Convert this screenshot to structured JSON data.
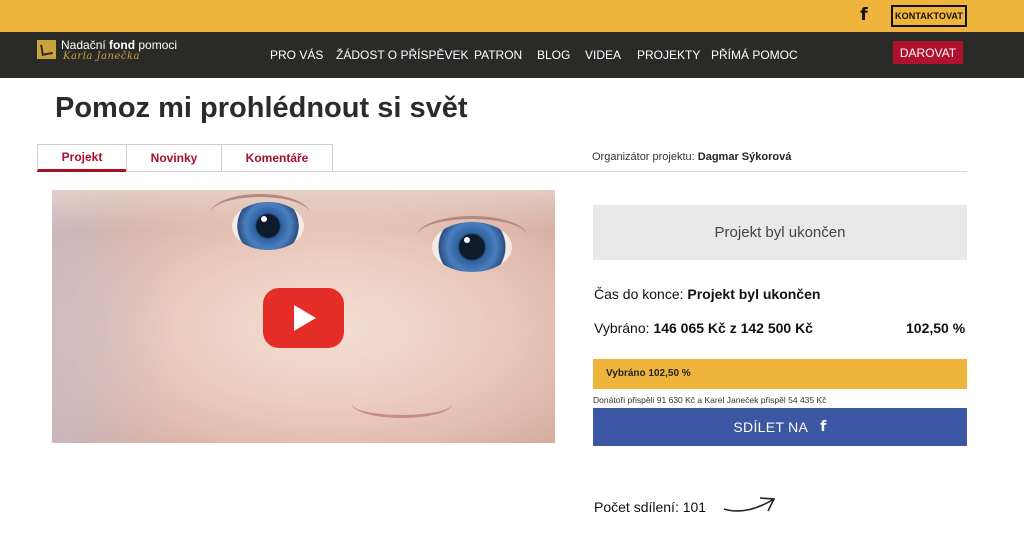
{
  "topbar": {
    "facebook_icon": "facebook-icon",
    "facebook_glyph": "f",
    "contact_label": "KONTAKTOVAT",
    "color": "#efb43b"
  },
  "nav": {
    "logo_line1_a": "Nadační ",
    "logo_line1_b": "fond",
    "logo_line1_c": " pomoci",
    "logo_line2": "Karla Janečka",
    "items": [
      "PRO VÁS",
      "ŽÁDOST O PŘÍSPĚVEK",
      "PATRON",
      "BLOG",
      "VIDEA",
      "PROJEKTY",
      "PŘÍMÁ POMOC"
    ],
    "donate_label": "DAROVAT",
    "color": "#2a2a28",
    "donate_color": "#b0122e"
  },
  "page": {
    "title": "Pomoz mi prohlédnout si svět",
    "tabs": [
      "Projekt",
      "Novinky",
      "Komentáře"
    ],
    "active_tab": "Projekt",
    "organizer_label": "Organizátor projektu: ",
    "organizer_name": "Dagmar Sýkorová"
  },
  "video": {
    "play_icon": "youtube-play-icon"
  },
  "project": {
    "status_box": "Projekt byl ukončen",
    "time_label": "Čas do konce: ",
    "time_value": "Projekt byl ukončen",
    "raised_label": "Vybráno: ",
    "raised_value": "146 065 Kč z 142 500 Kč",
    "percent": "102,50 %",
    "progress_fraction": 1.0,
    "progress_label": "Vybráno 102,50 %",
    "donors_note": "Donátoři přispěli 91 630 Kč a Karel Janeček přispěl 54 435 Kč",
    "share_label": "SDÍLET NA",
    "share_icon": "facebook-icon",
    "share_glyph": "f",
    "share_count_label": "Počet sdílení: 101",
    "accent_color": "#a8102a",
    "share_color": "#3b56a3"
  }
}
